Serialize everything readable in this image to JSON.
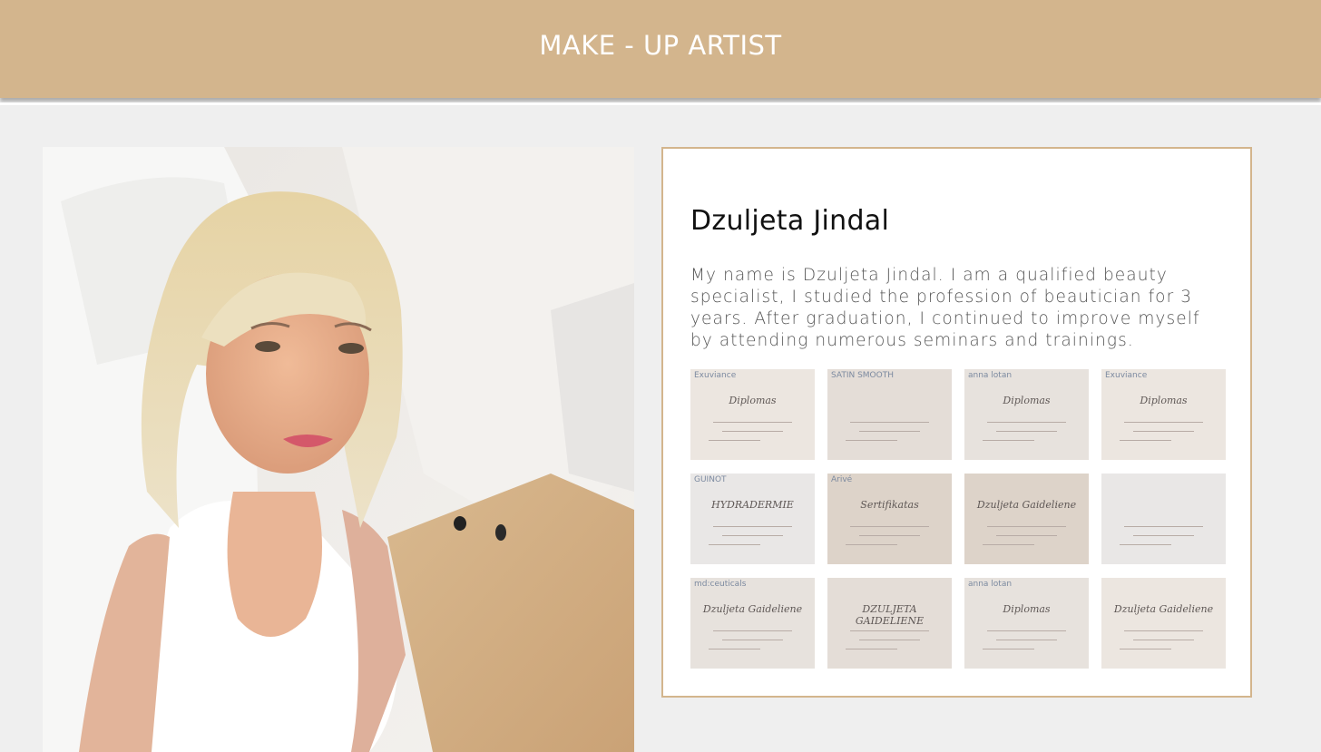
{
  "header": {
    "title": "MAKE - UP ARTIST",
    "background_color": "#d3b58d"
  },
  "profile": {
    "name": "Dzuljeta Jindal",
    "bio": "My name is Dzuljeta Jindal. I am a qualified beauty specialist, I studied the profession of beautician for 3 years. After graduation, I continued to improve myself by attending numerous seminars and trainings.",
    "card_border_color": "#d3b58d"
  },
  "certificates": [
    {
      "brand": "Exuviance",
      "headline": "Diplomas"
    },
    {
      "brand": "SATIN SMOOTH",
      "headline": ""
    },
    {
      "brand": "anna lotan",
      "headline": "Diplomas"
    },
    {
      "brand": "Exuviance",
      "headline": "Diplomas"
    },
    {
      "brand": "GUINOT",
      "headline": "HYDRADERMIE"
    },
    {
      "brand": "Arivé",
      "headline": "Sertifikatas"
    },
    {
      "brand": "",
      "headline": "Dzuljeta Gaideliene"
    },
    {
      "brand": "",
      "headline": ""
    },
    {
      "brand": "md:ceuticals",
      "headline": "Dzuljeta Gaideliene"
    },
    {
      "brand": "",
      "headline": "DZULJETA GAIDELIENE"
    },
    {
      "brand": "anna lotan",
      "headline": "Diplomas"
    },
    {
      "brand": "",
      "headline": "Dzuljeta Gaideliene"
    }
  ]
}
